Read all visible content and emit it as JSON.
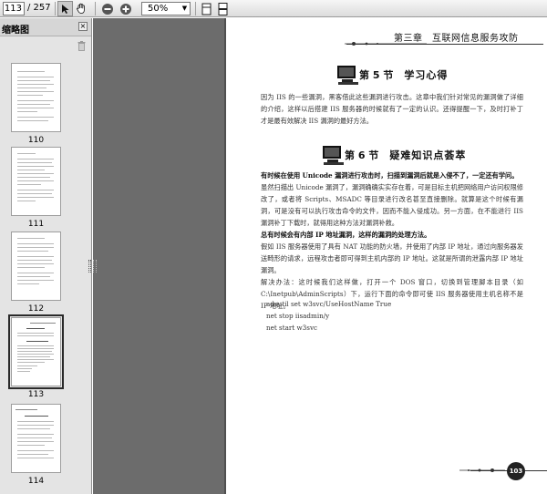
{
  "toolbar": {
    "current_page": "113",
    "total_pages": "/ 257",
    "zoom": "50%",
    "icons": [
      "select-tool-icon",
      "hand-tool-icon",
      "zoom-out-icon",
      "zoom-in-icon",
      "single-page-icon",
      "continuous-page-icon"
    ]
  },
  "sidebar": {
    "title": "缩略图",
    "close_glyph": "×",
    "thumbnails": [
      {
        "label": "110"
      },
      {
        "label": "111"
      },
      {
        "label": "112"
      },
      {
        "label": "113"
      },
      {
        "label": "114"
      }
    ]
  },
  "document": {
    "running_head": "第三章　互联网信息服务攻防",
    "section5": {
      "number": "第 5 节",
      "title": "学习心得",
      "body": "因为 IIS 的一些漏洞，黑客借此这些漏洞进行攻击。这章中我们针对常见的漏洞做了详细的介绍，这样以后搭建 IIS 服务器的时候就有了一定的认识。还得提醒一下，及时打补丁才是最有效解决 IIS 漏洞的最好方法。"
    },
    "section6": {
      "number": "第 6 节",
      "title": "疑难知识点荟萃",
      "q1": "有时候在使用 Unicode 漏洞进行攻击时，扫描到漏洞后就是入侵不了，一定还有学问。",
      "a1": "虽然扫描出 Unicode 漏洞了，漏洞确确实实存在着，可是目标主机把网络用户访问权限修改了，或者将 Scripts、MSADC 等目录进行改名甚至直接删除。就算是这个时候有漏洞，可是没有可以执行攻击命令的文件，因而不能入侵成功。另一方面，在不能进行 IIS 漏洞补丁下载时，就得用这种方法对漏洞补救。",
      "q2": "总有时候会有内部 IP 地址漏洞，这样的漏洞的处理方法。",
      "a2": "假如 IIS 服务器使用了具有 NAT 功能的防火墙，并使用了内部 IP 地址，通过向服务器发送畸形的请求，远程攻击者即可得到主机内部的 IP 地址。这就是所谓的泄露内部 IP 地址漏洞。",
      "a3": "解决办法：这时候我们这样做，打开一个 DOS 窗口，切换到管理脚本目录（如 C:\\Inetpub\\AdminScripts）下，运行下面的命令即可使 IIS 服务器使用主机名称不是 IP 地址。",
      "cmd1": "adsutil set w3svc/UseHostName True",
      "cmd2": "net stop iisadmin/y",
      "cmd3": "net start w3svc"
    },
    "page_number": "103"
  }
}
